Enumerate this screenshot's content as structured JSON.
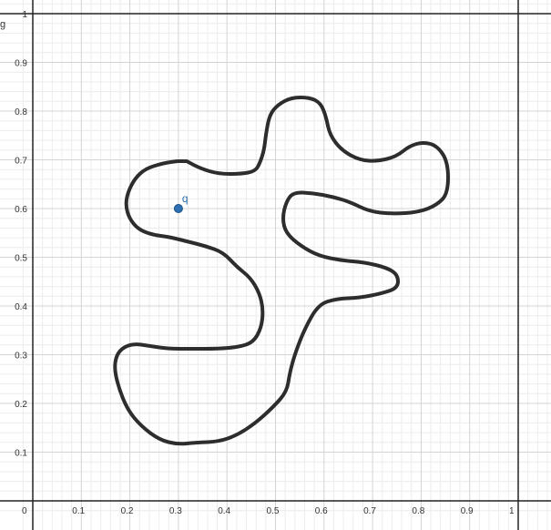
{
  "graph": {
    "x_ticks": [
      "0",
      "0.1",
      "0.2",
      "0.3",
      "0.4",
      "0.5",
      "0.6",
      "0.7",
      "0.8",
      "0.9",
      "1"
    ],
    "y_ticks": [
      "0.1",
      "0.2",
      "0.3",
      "0.4",
      "0.5",
      "0.6",
      "0.7",
      "0.8",
      "0.9",
      "1"
    ],
    "y_axis_label": "g",
    "point": {
      "label": "q",
      "x": 0.3,
      "y": 0.6,
      "color": "#2d70b3"
    },
    "curve_color": "#2d2d2d",
    "grid_color_major": "#d4d4d4",
    "grid_color_minor": "#ececec",
    "axis_color": "#222222"
  }
}
